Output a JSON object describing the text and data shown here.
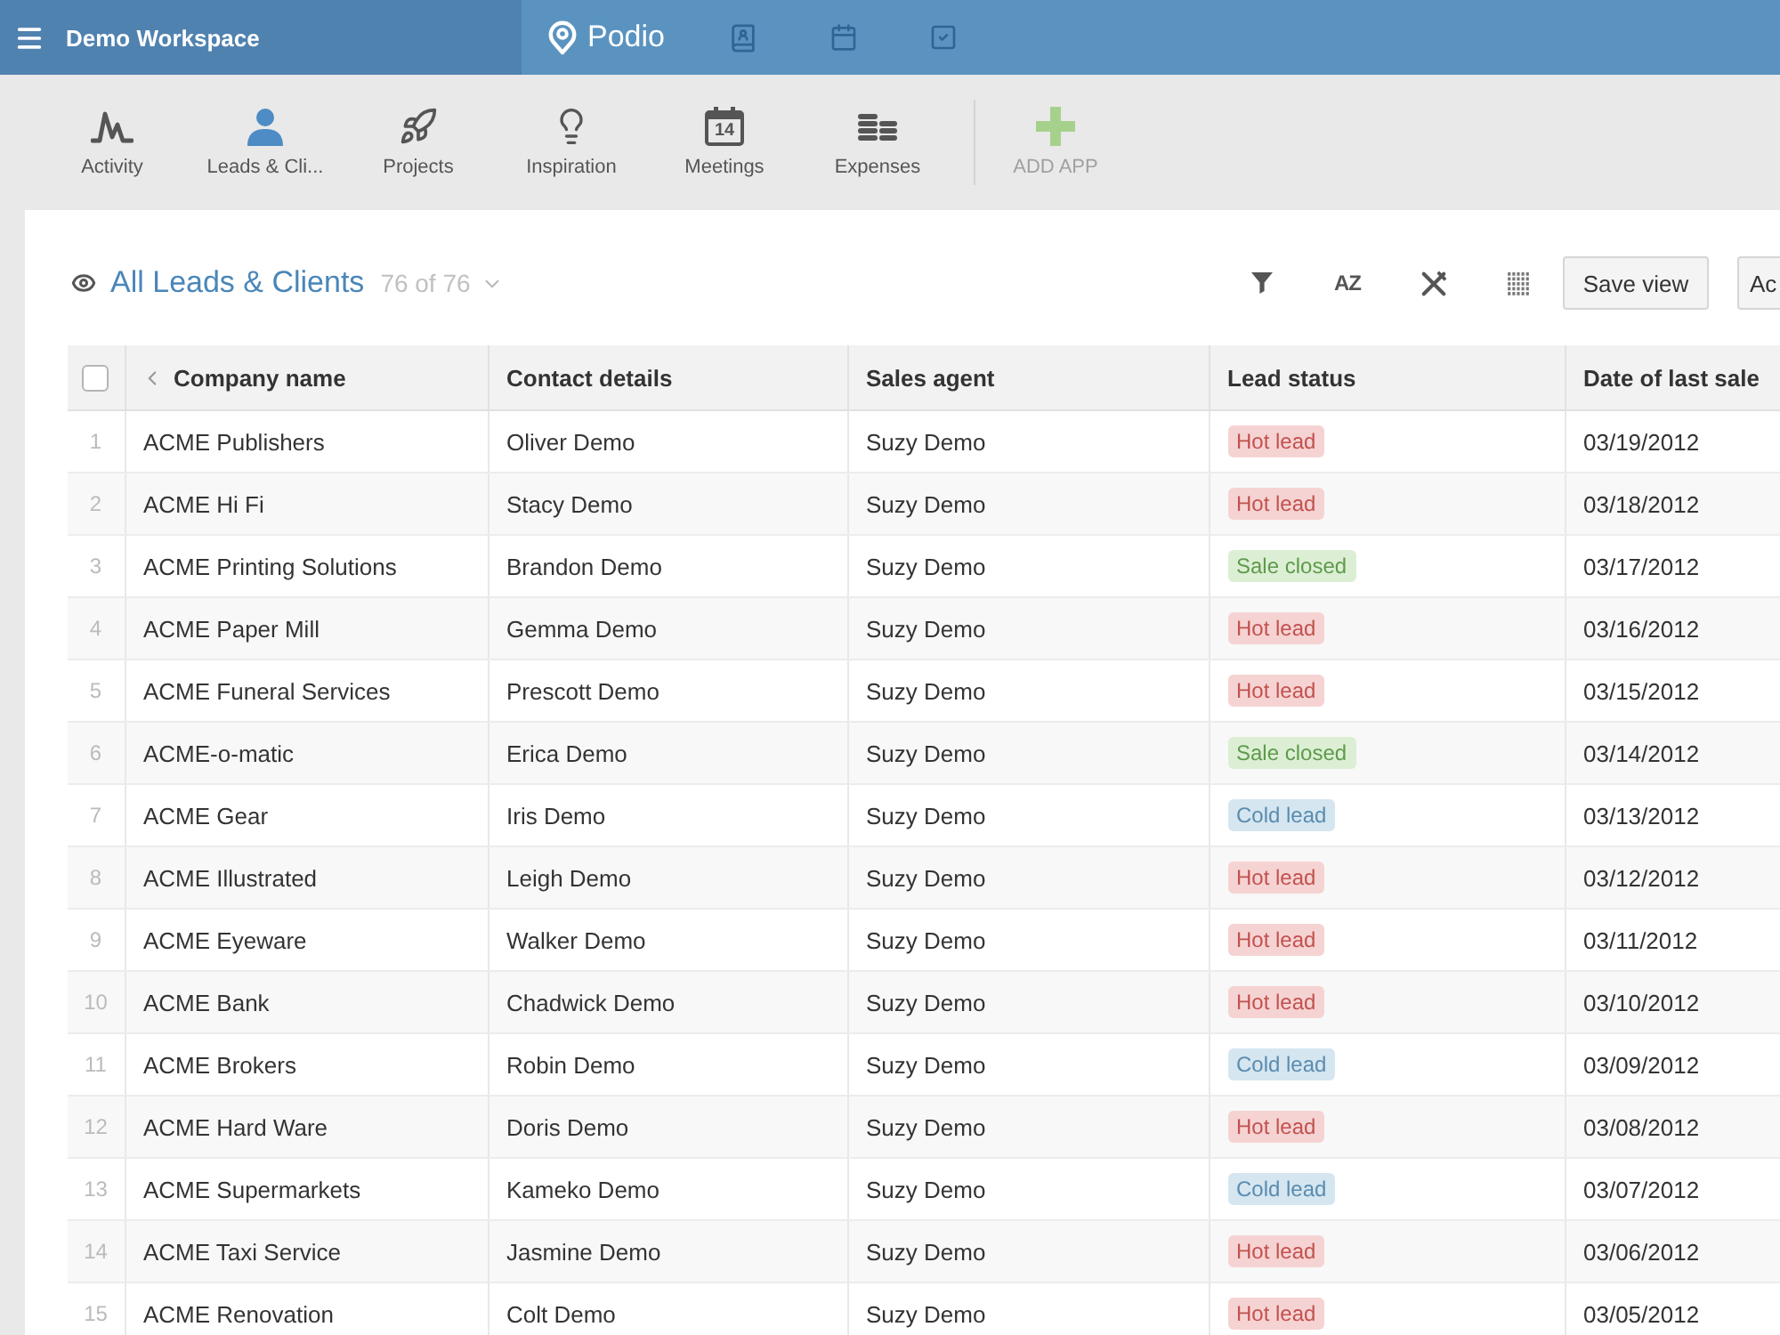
{
  "top_bar": {
    "workspace": "Demo Workspace",
    "logo": "Podio"
  },
  "apps": [
    {
      "label": "Activity",
      "selected": false
    },
    {
      "label": "Leads & Cli...",
      "selected": true
    },
    {
      "label": "Projects",
      "selected": false
    },
    {
      "label": "Inspiration",
      "selected": false
    },
    {
      "label": "Meetings",
      "selected": false,
      "calendar_day": "14"
    },
    {
      "label": "Expenses",
      "selected": false
    }
  ],
  "add_app": {
    "label": "ADD APP"
  },
  "view": {
    "title": "All Leads & Clients",
    "count": "76 of 76"
  },
  "toolbar": {
    "sort_label": "AZ",
    "buttons": [
      "Save view",
      "Ac"
    ]
  },
  "table": {
    "select_all": {
      "checked": false
    },
    "columns": [
      "Company name",
      "Contact details",
      "Sales agent",
      "Lead status",
      "Date of last sale"
    ],
    "rows": [
      {
        "number": "1",
        "company": "ACME Publishers",
        "contact": "Oliver Demo",
        "agent": "Suzy Demo",
        "status": {
          "label": "Hot lead",
          "kind": "hot"
        },
        "date": "03/19/2012"
      },
      {
        "number": "2",
        "company": "ACME Hi Fi",
        "contact": "Stacy Demo",
        "agent": "Suzy Demo",
        "status": {
          "label": "Hot lead",
          "kind": "hot"
        },
        "date": "03/18/2012"
      },
      {
        "number": "3",
        "company": "ACME Printing Solutions",
        "contact": "Brandon Demo",
        "agent": "Suzy Demo",
        "status": {
          "label": "Sale closed",
          "kind": "closed"
        },
        "date": "03/17/2012"
      },
      {
        "number": "4",
        "company": "ACME Paper Mill",
        "contact": "Gemma Demo",
        "agent": "Suzy Demo",
        "status": {
          "label": "Hot lead",
          "kind": "hot"
        },
        "date": "03/16/2012"
      },
      {
        "number": "5",
        "company": "ACME Funeral Services",
        "contact": "Prescott Demo",
        "agent": "Suzy Demo",
        "status": {
          "label": "Hot lead",
          "kind": "hot"
        },
        "date": "03/15/2012"
      },
      {
        "number": "6",
        "company": "ACME-o-matic",
        "contact": "Erica Demo",
        "agent": "Suzy Demo",
        "status": {
          "label": "Sale closed",
          "kind": "closed"
        },
        "date": "03/14/2012"
      },
      {
        "number": "7",
        "company": "ACME Gear",
        "contact": "Iris Demo",
        "agent": "Suzy Demo",
        "status": {
          "label": "Cold lead",
          "kind": "cold"
        },
        "date": "03/13/2012"
      },
      {
        "number": "8",
        "company": "ACME Illustrated",
        "contact": "Leigh Demo",
        "agent": "Suzy Demo",
        "status": {
          "label": "Hot lead",
          "kind": "hot"
        },
        "date": "03/12/2012"
      },
      {
        "number": "9",
        "company": "ACME Eyeware",
        "contact": "Walker Demo",
        "agent": "Suzy Demo",
        "status": {
          "label": "Hot lead",
          "kind": "hot"
        },
        "date": "03/11/2012"
      },
      {
        "number": "10",
        "company": "ACME Bank",
        "contact": "Chadwick Demo",
        "agent": "Suzy Demo",
        "status": {
          "label": "Hot lead",
          "kind": "hot"
        },
        "date": "03/10/2012"
      },
      {
        "number": "11",
        "company": "ACME Brokers",
        "contact": "Robin Demo",
        "agent": "Suzy Demo",
        "status": {
          "label": "Cold lead",
          "kind": "cold"
        },
        "date": "03/09/2012"
      },
      {
        "number": "12",
        "company": "ACME Hard Ware",
        "contact": "Doris Demo",
        "agent": "Suzy Demo",
        "status": {
          "label": "Hot lead",
          "kind": "hot"
        },
        "date": "03/08/2012"
      },
      {
        "number": "13",
        "company": "ACME Supermarkets",
        "contact": "Kameko Demo",
        "agent": "Suzy Demo",
        "status": {
          "label": "Cold lead",
          "kind": "cold"
        },
        "date": "03/07/2012"
      },
      {
        "number": "14",
        "company": "ACME Taxi Service",
        "contact": "Jasmine Demo",
        "agent": "Suzy Demo",
        "status": {
          "label": "Hot lead",
          "kind": "hot"
        },
        "date": "03/06/2012"
      },
      {
        "number": "15",
        "company": "ACME Renovation",
        "contact": "Colt Demo",
        "agent": "Suzy Demo",
        "status": {
          "label": "Hot lead",
          "kind": "hot"
        },
        "date": "03/05/2012"
      }
    ]
  }
}
